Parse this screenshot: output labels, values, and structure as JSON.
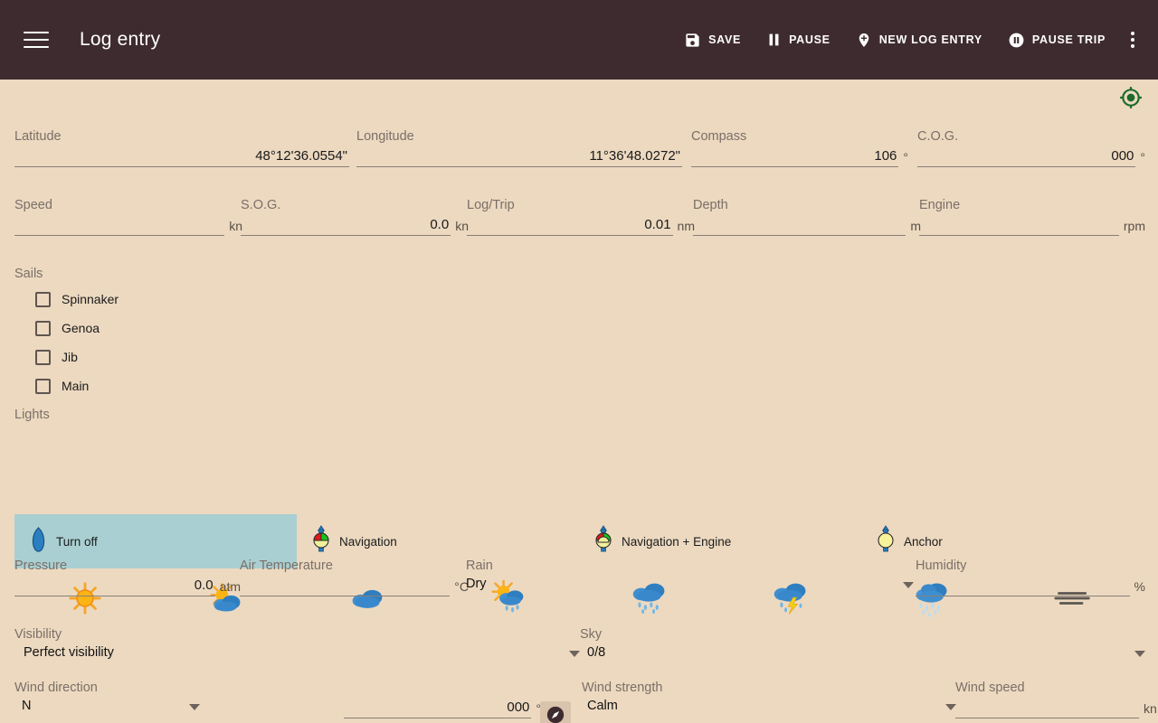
{
  "appbar": {
    "menu_icon": "hamburger-menu-icon",
    "title": "Log entry",
    "actions": [
      {
        "icon": "save-icon",
        "label": "SAVE"
      },
      {
        "icon": "pause-icon",
        "label": "PAUSE"
      },
      {
        "icon": "map-pin-plus-icon",
        "label": "NEW LOG ENTRY"
      },
      {
        "icon": "pause-circle-icon",
        "label": "PAUSE TRIP"
      }
    ],
    "overflow_icon": "kebab-menu-icon"
  },
  "gps": {
    "icon": "gps-fixed-icon",
    "color": "#1b6b2a"
  },
  "position": {
    "latitude": {
      "label": "Latitude",
      "value": "48°12'36.0554\"",
      "unit": ""
    },
    "longitude": {
      "label": "Longitude",
      "value": "11°36'48.0272\"",
      "unit": ""
    },
    "compass": {
      "label": "Compass",
      "value": "106",
      "unit": "°"
    },
    "cog": {
      "label": "C.O.G.",
      "value": "000",
      "unit": "°"
    }
  },
  "motion": {
    "speed": {
      "label": "Speed",
      "value": "",
      "unit": "kn"
    },
    "sog": {
      "label": "S.O.G.",
      "value": "0.0",
      "unit": "kn"
    },
    "logtrip": {
      "label": "Log/Trip",
      "value": "0.01",
      "unit": "nm"
    },
    "depth": {
      "label": "Depth",
      "value": "",
      "unit": "m"
    },
    "engine": {
      "label": "Engine",
      "value": "",
      "unit": "rpm"
    }
  },
  "sails": {
    "label": "Sails",
    "items": [
      {
        "label": "Spinnaker",
        "checked": false
      },
      {
        "label": "Genoa",
        "checked": false
      },
      {
        "label": "Jib",
        "checked": false
      },
      {
        "label": "Main",
        "checked": false
      }
    ]
  },
  "lights": {
    "label": "Lights",
    "items": [
      {
        "label": "Turn off",
        "icon": "light-off-icon",
        "selected": true
      },
      {
        "label": "Navigation",
        "icon": "navigation-light-icon",
        "selected": false
      },
      {
        "label": "Navigation + Engine",
        "icon": "nav-engine-light-icon",
        "selected": false
      },
      {
        "label": "Anchor",
        "icon": "anchor-light-icon",
        "selected": false
      }
    ]
  },
  "weather_icons": [
    {
      "name": "sunny-icon"
    },
    {
      "name": "partly-cloudy-icon"
    },
    {
      "name": "cloudy-icon"
    },
    {
      "name": "sun-shower-icon"
    },
    {
      "name": "rain-icon"
    },
    {
      "name": "thunderstorm-icon"
    },
    {
      "name": "heavy-rain-icon"
    },
    {
      "name": "fog-icon"
    }
  ],
  "atmosphere": {
    "pressure": {
      "label": "Pressure",
      "value": "0.0",
      "unit": "atm"
    },
    "air_temp": {
      "label": "Air Temperature",
      "value": "",
      "unit": "°C"
    },
    "rain": {
      "label": "Rain",
      "value": "Dry"
    },
    "humidity": {
      "label": "Humidity",
      "value": "",
      "unit": "%"
    }
  },
  "conditions": {
    "visibility": {
      "label": "Visibility",
      "value": "Perfect visibility"
    },
    "sky": {
      "label": "Sky",
      "value": "0/8"
    }
  },
  "wind": {
    "direction": {
      "label": "Wind direction",
      "value": "N",
      "degrees": "000",
      "unit": "°"
    },
    "compass_icon": "compass-rose-icon",
    "strength": {
      "label": "Wind strength",
      "value": "Calm"
    },
    "speed": {
      "label": "Wind speed",
      "value": "",
      "unit": "kn"
    }
  }
}
